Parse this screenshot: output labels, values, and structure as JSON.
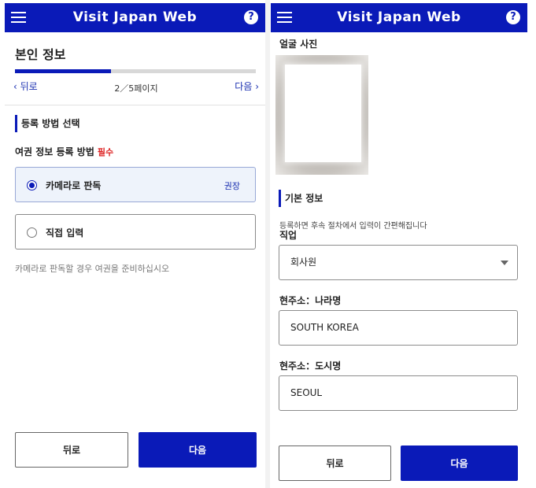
{
  "app": {
    "title": "Visit Japan Web",
    "help": "?"
  },
  "colors": {
    "brand": "#0a1ab8",
    "required": "#dd2222",
    "selected_bg": "#eef3fb"
  },
  "icons": {
    "menu": "hamburger-menu-icon",
    "help": "question-circle-icon",
    "radio_on": "radio-selected-icon",
    "radio_off": "radio-unselected-icon",
    "dropdown": "triangle-down-icon"
  },
  "left": {
    "page_title": "본인 정보",
    "progress": {
      "current": 2,
      "total": 5,
      "fraction": 0.4
    },
    "nav": {
      "back": "‹ 뒤로",
      "page_indicator": "2／5페이지",
      "next": "다음 ›"
    },
    "section_title": "등록 방법 선택",
    "field_label": "여권 정보 등록 방법",
    "required_badge": "필수",
    "options": [
      {
        "label": "카메라로 판독",
        "badge": "권장",
        "selected": true
      },
      {
        "label": "직접 입력",
        "badge": "",
        "selected": false
      }
    ],
    "hint": "카메라로 판독할 경우 여권을 준비하십시오",
    "buttons": {
      "back": "뒤로",
      "next": "다음"
    }
  },
  "right": {
    "photo_label": "얼굴 사진",
    "section_title": "기본 정보",
    "hint": "등록하면 후속 절차에서 입력이 간편해집니다",
    "fields": {
      "occupation": {
        "label": "직업",
        "value": "회사원"
      },
      "country": {
        "label": "현주소：나라명",
        "value": "SOUTH KOREA"
      },
      "city": {
        "label": "현주소：도시명",
        "value": "SEOUL"
      }
    },
    "buttons": {
      "back": "뒤로",
      "next": "다음"
    }
  }
}
